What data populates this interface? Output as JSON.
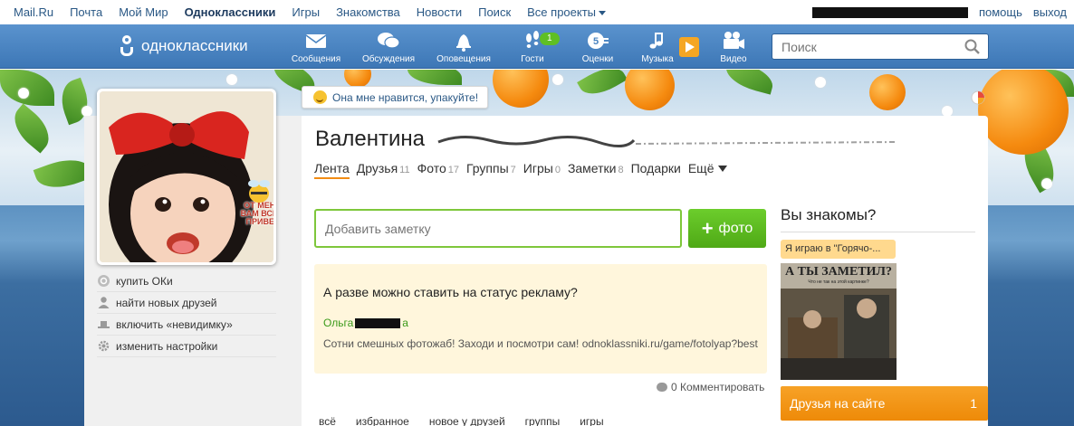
{
  "portal": {
    "links": [
      "Mail.Ru",
      "Почта",
      "Мой Мир",
      "Одноклассники",
      "Игры",
      "Знакомства",
      "Новости",
      "Поиск",
      "Все проекты"
    ],
    "help": "помощь",
    "logout": "выход"
  },
  "navbar": {
    "logo": "одноклассники",
    "items": [
      "Сообщения",
      "Обсуждения",
      "Оповещения",
      "Гости",
      "Оценки",
      "Музыка",
      "Видео"
    ],
    "guests_badge": "1",
    "search_placeholder": "Поиск"
  },
  "profile": {
    "like_button": "Она мне нравится, упакуйте!",
    "name": "Валентина",
    "tabs": [
      {
        "label": "Лента",
        "count": ""
      },
      {
        "label": "Друзья",
        "count": "11"
      },
      {
        "label": "Фото",
        "count": "17"
      },
      {
        "label": "Группы",
        "count": "7"
      },
      {
        "label": "Игры",
        "count": "0"
      },
      {
        "label": "Заметки",
        "count": "8"
      },
      {
        "label": "Подарки",
        "count": ""
      },
      {
        "label": "Ещё",
        "count": ""
      }
    ],
    "avatar_sticker": "ОТ МЕНЯ ВАМ ВСЕМ ПРИВЕТ",
    "menu": [
      "купить ОКи",
      "найти новых друзей",
      "включить «невидимку»",
      "изменить настройки"
    ]
  },
  "feed": {
    "note_placeholder": "Добавить заметку",
    "photo_button": "фото",
    "post_question": "А разве можно ставить на статус рекламу?",
    "post_author_first": "Ольга",
    "post_author_suffix": "а",
    "post_text": "Сотни смешных фотожаб! Заходи и посмотри сам! odnoklassniki.ru/game/fotolyap?best",
    "comments": "0 Комментировать",
    "filter_tabs": [
      "всё",
      "избранное",
      "новое у друзей",
      "группы",
      "игры"
    ]
  },
  "sidebar": {
    "title": "Вы знакомы?",
    "game_label": "Я играю в \"Горячо-...",
    "game_image_title": "А ТЫ ЗАМЕТИЛ?",
    "game_image_sub": "Что не так на этой картинке?",
    "friends_online": "Друзья на сайте",
    "friends_online_count": "1"
  }
}
